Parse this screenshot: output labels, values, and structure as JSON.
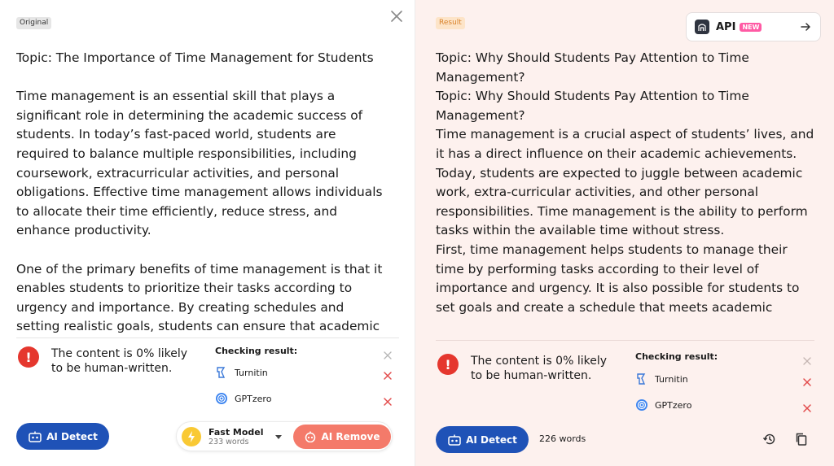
{
  "left": {
    "tag": "Original",
    "paragraphs": [
      "Topic: The Importance of Time Management for Students",
      "Time management is an essential skill that plays a significant role in determining the academic success of students. In today’s fast-paced world, students are required to balance multiple responsibilities, including coursework, extracurricular activities, and personal obligations. Effective time management allows individuals to allocate their time efficiently, reduce stress, and enhance productivity.",
      "One of the primary benefits of time management is that it enables students to prioritize their tasks according to urgency and importance. By creating schedules and setting realistic goals, students can ensure that academic"
    ],
    "detect_text": "The content is 0% likely to be human-written.",
    "checking_title": "Checking result:",
    "checkers": [
      "Turnitin",
      "GPTzero"
    ],
    "detect_button": "AI Detect",
    "model_name": "Fast Model",
    "model_words": "233 words",
    "remove_button": "AI Remove"
  },
  "right": {
    "tag": "Result",
    "api_label": "API",
    "api_badge": "NEW",
    "paragraphs": [
      "Topic: Why Should Students Pay Attention to Time Management?",
      "Topic: Why Should Students Pay Attention to Time Management?",
      "Time management is a crucial aspect of students’ lives, and it has a direct influence on their academic achievements. Today, students are expected to juggle between academic work, extra-curricular activities, and other personal responsibilities. Time management is the ability to perform tasks within the available time without stress.",
      "First, time management helps students to manage their time by performing tasks according to their level of importance and urgency. It is also possible for students to set goals and create a schedule that meets academic"
    ],
    "detect_text": "The content is 0% likely to be human-written.",
    "checking_title": "Checking result:",
    "checkers": [
      "Turnitin",
      "GPTzero"
    ],
    "detect_button": "AI Detect",
    "word_count": "226 words"
  },
  "colors": {
    "primary_blue": "#1f52b7",
    "danger_red": "#e5372e",
    "remove_coral": "#f47a6a",
    "result_bg": "#fdf1ee"
  },
  "icons": [
    "close-icon",
    "api-logo-icon",
    "arrow-right-icon",
    "warning-icon",
    "turnitin-icon",
    "gptzero-icon",
    "x-icon",
    "robot-icon",
    "bolt-icon",
    "history-icon",
    "copy-icon"
  ]
}
